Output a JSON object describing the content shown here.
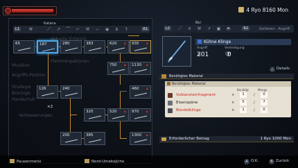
{
  "hud": {
    "money": "4 Ryo 8160 Mon"
  },
  "tree": {
    "category_label": "Katana",
    "btn_left": "L1",
    "btn_right": "R1",
    "ghost_rows": [
      "Aktuelle Entwickl...",
      "Flammenpatronen",
      "Munition",
      "Angriffs-Position",
      "Strategie",
      "Brüchige",
      "Handschuh",
      "Verbesserungen"
    ],
    "multiplier": "×2",
    "nodes": [
      {
        "num": "65"
      },
      {
        "num": "187"
      },
      {
        "num": "280"
      },
      {
        "num": "383"
      },
      {
        "num": "620"
      },
      {
        "num": "935"
      },
      {
        "num": "750"
      },
      {
        "num": "1130"
      },
      {
        "num": "460"
      },
      {
        "num": "126"
      },
      {
        "num": "240"
      },
      {
        "num": "320"
      },
      {
        "num": "520"
      },
      {
        "num": "970"
      },
      {
        "num": "200"
      },
      {
        "num": "385"
      },
      {
        "num": "1300"
      }
    ]
  },
  "detail": {
    "category_label": "Bei",
    "btn_left": "L2",
    "btn_right": "R2",
    "sort_label": "Sortieren : Angriff",
    "weapon_name": "Kühne Klinge",
    "attack_label": "Angriff",
    "attack_value": "201",
    "defense_label": "Verteidigung",
    "defense_value": "0",
    "details_label": "Details",
    "required_material_header": "Benötigtes Material",
    "materials_title": "Benötigtes Material",
    "col_required": "Benötigt",
    "col_amount": "Menge",
    "materials": [
      {
        "name": "Vulkansteinfragment",
        "x": "×",
        "need": "1",
        "slash": "/",
        "have": "0",
        "color": "#cc2a22"
      },
      {
        "name": "Eisenspäne",
        "x": "×",
        "need": "5",
        "slash": "/",
        "have": "7",
        "color": "#222222"
      },
      {
        "name": "Bündelklinge",
        "x": "×",
        "need": "1",
        "slash": "/",
        "have": "0",
        "color": "#cc2a22"
      }
    ],
    "cost_label": "Erforderlicher Betrag",
    "cost_value": "1 Ryo 1000 Mon"
  },
  "bottom": {
    "pause": "Pausenmenü",
    "location": "Nord-Umekojicho",
    "ok_btn": "A",
    "ok_label": "O.K.",
    "back_btn": "B",
    "back_label": "Zurück"
  }
}
